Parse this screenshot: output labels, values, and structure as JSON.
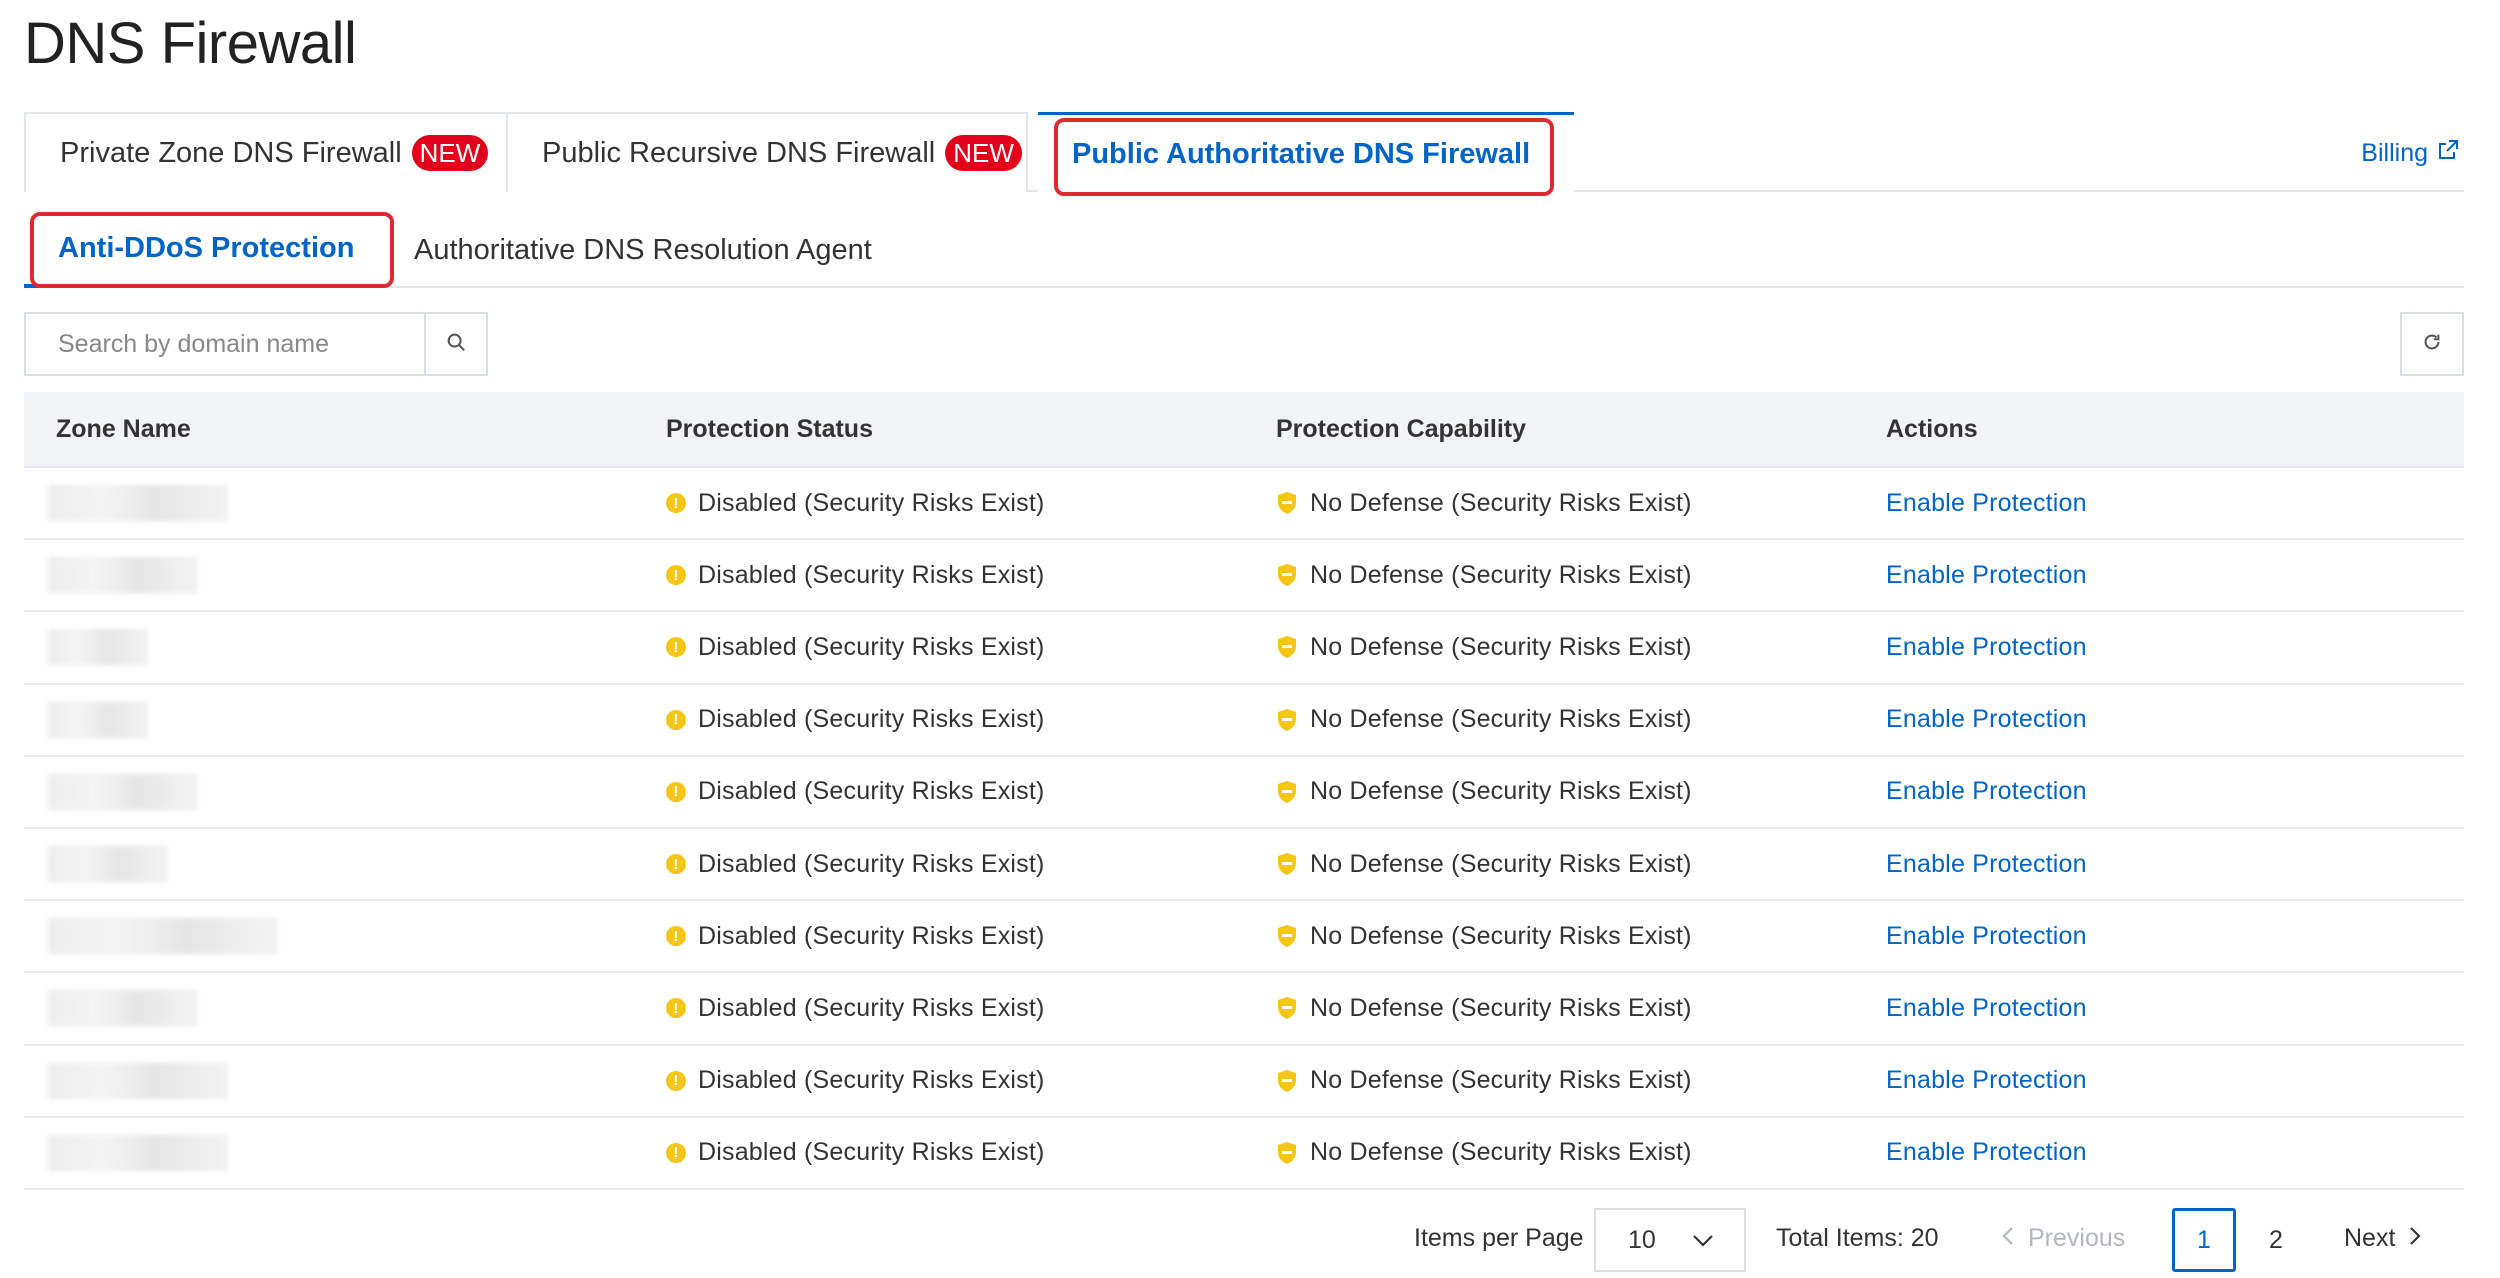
{
  "page": {
    "title": "DNS Firewall"
  },
  "tabs": [
    {
      "label": "Private Zone DNS Firewall",
      "badge": "NEW"
    },
    {
      "label": "Public Recursive DNS Firewall",
      "badge": "NEW"
    },
    {
      "label": "Public Authoritative DNS Firewall",
      "badge": ""
    }
  ],
  "billing": {
    "label": "Billing"
  },
  "subtabs": [
    {
      "label": "Anti-DDoS Protection"
    },
    {
      "label": "Authoritative DNS Resolution Agent"
    }
  ],
  "search": {
    "placeholder": "Search by domain name"
  },
  "table": {
    "headers": [
      "Zone Name",
      "Protection Status",
      "Protection Capability",
      "Actions"
    ],
    "rows": [
      {
        "status": "Disabled (Security Risks Exist)",
        "capability": "No Defense (Security Risks Exist)",
        "action": "Enable Protection"
      },
      {
        "status": "Disabled (Security Risks Exist)",
        "capability": "No Defense (Security Risks Exist)",
        "action": "Enable Protection"
      },
      {
        "status": "Disabled (Security Risks Exist)",
        "capability": "No Defense (Security Risks Exist)",
        "action": "Enable Protection"
      },
      {
        "status": "Disabled (Security Risks Exist)",
        "capability": "No Defense (Security Risks Exist)",
        "action": "Enable Protection"
      },
      {
        "status": "Disabled (Security Risks Exist)",
        "capability": "No Defense (Security Risks Exist)",
        "action": "Enable Protection"
      },
      {
        "status": "Disabled (Security Risks Exist)",
        "capability": "No Defense (Security Risks Exist)",
        "action": "Enable Protection"
      },
      {
        "status": "Disabled (Security Risks Exist)",
        "capability": "No Defense (Security Risks Exist)",
        "action": "Enable Protection"
      },
      {
        "status": "Disabled (Security Risks Exist)",
        "capability": "No Defense (Security Risks Exist)",
        "action": "Enable Protection"
      },
      {
        "status": "Disabled (Security Risks Exist)",
        "capability": "No Defense (Security Risks Exist)",
        "action": "Enable Protection"
      },
      {
        "status": "Disabled (Security Risks Exist)",
        "capability": "No Defense (Security Risks Exist)",
        "action": "Enable Protection"
      }
    ]
  },
  "pagination": {
    "items_per_page_label": "Items per Page",
    "items_per_page": "10",
    "total_label": "Total Items: 20",
    "prev_label": "Previous",
    "next_label": "Next",
    "pages": [
      "1",
      "2"
    ],
    "current_page": "1"
  },
  "colors": {
    "accent": "#0064c8",
    "new_badge": "#e3001b",
    "warning": "#f5c518",
    "highlight": "#e02a32"
  },
  "icons": {
    "status": "exclamation-circle-icon",
    "capability": "shield-icon",
    "search": "search-icon",
    "refresh": "refresh-icon",
    "billing": "external-link-icon"
  }
}
